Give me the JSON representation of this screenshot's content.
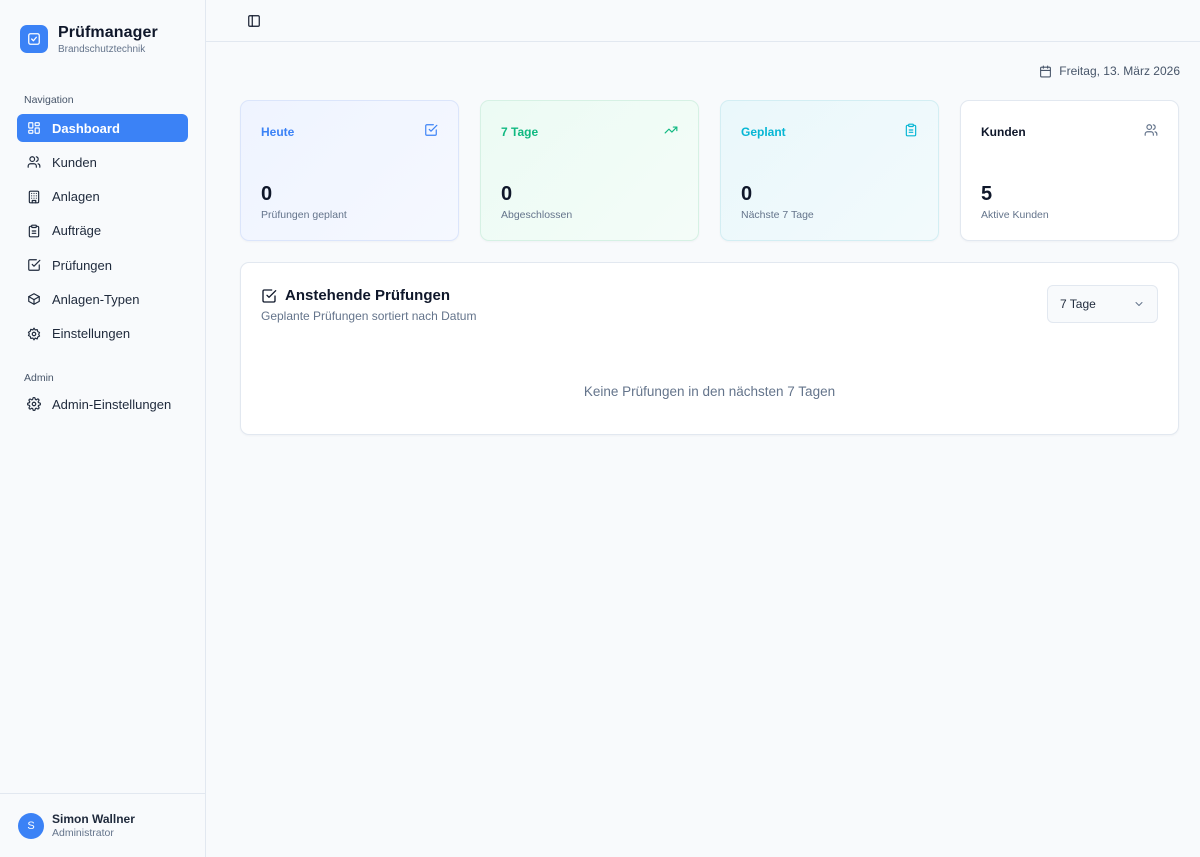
{
  "brand": {
    "title": "Prüfmanager",
    "subtitle": "Brandschutztechnik"
  },
  "sidebar": {
    "sections": [
      {
        "label": "Navigation",
        "items": [
          {
            "label": "Dashboard",
            "icon": "dashboard-icon",
            "active": true
          },
          {
            "label": "Kunden",
            "icon": "users-icon"
          },
          {
            "label": "Anlagen",
            "icon": "building-icon"
          },
          {
            "label": "Aufträge",
            "icon": "clipboard-icon"
          },
          {
            "label": "Prüfungen",
            "icon": "checkbox-icon"
          },
          {
            "label": "Anlagen-Typen",
            "icon": "package-icon"
          },
          {
            "label": "Einstellungen",
            "icon": "settings-icon"
          }
        ]
      },
      {
        "label": "Admin",
        "items": [
          {
            "label": "Admin-Einstellungen",
            "icon": "gear-icon"
          }
        ]
      }
    ]
  },
  "user": {
    "initial": "S",
    "name": "Simon Wallner",
    "role": "Administrator"
  },
  "header": {
    "date": "Freitag, 13. März 2026"
  },
  "stats": [
    {
      "title": "Heute",
      "value": "0",
      "sub": "Prüfungen geplant",
      "icon": "check-square-icon",
      "color": "#3b82f6"
    },
    {
      "title": "7 Tage",
      "value": "0",
      "sub": "Abgeschlossen",
      "icon": "trending-up-icon",
      "color": "#10b981"
    },
    {
      "title": "Geplant",
      "value": "0",
      "sub": "Nächste 7 Tage",
      "icon": "clipboard-list-icon",
      "color": "#06b6d4"
    },
    {
      "title": "Kunden",
      "value": "5",
      "sub": "Aktive Kunden",
      "icon": "users-icon",
      "color": "#64748b"
    }
  ],
  "upcoming": {
    "title": "Anstehende Prüfungen",
    "subtitle": "Geplante Prüfungen sortiert nach Datum",
    "range": "7 Tage",
    "empty": "Keine Prüfungen in den nächsten 7 Tagen"
  },
  "colors": {
    "accent": "#3b82f6",
    "green": "#10b981",
    "teal": "#06b6d4"
  }
}
